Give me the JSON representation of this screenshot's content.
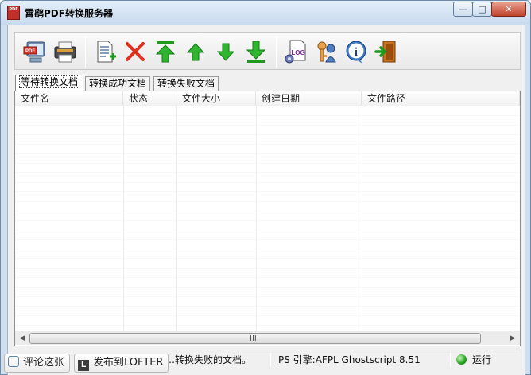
{
  "window": {
    "title": "霄鹞PDF转换服务器",
    "icon_text": "PDF",
    "buttons": {
      "minimize": "—",
      "maximize": "□",
      "close": "✕"
    }
  },
  "toolbar": {
    "icons": [
      "pdf-computer-icon",
      "printer-icon",
      "add-file-icon",
      "delete-icon",
      "move-top-icon",
      "move-up-icon",
      "move-down-icon",
      "move-bottom-icon",
      "log-icon",
      "user-key-icon",
      "info-icon",
      "exit-icon"
    ],
    "log_label": "LOG",
    "info_label": "i"
  },
  "tabs": [
    {
      "label": "等待转换文档",
      "active": true
    },
    {
      "label": "转换成功文档",
      "active": false
    },
    {
      "label": "转换失败文档",
      "active": false
    }
  ],
  "table": {
    "columns": [
      "文件名",
      "状态",
      "文件大小",
      "创建日期",
      "文件路径"
    ]
  },
  "scrollbar": {
    "grip": "III",
    "left_arrow": "◀",
    "right_arrow": "▶"
  },
  "status": {
    "text": "…转换失败的文档。",
    "engine": "PS 引擎:AFPL Ghostscript 8.51",
    "state": "运行"
  },
  "overlay": {
    "comment_label": "评论这张",
    "lofter_icon": "L",
    "lofter_label": "发布到LOFTER"
  },
  "colors": {
    "accent": "#cfdff0",
    "status_running": "#1fa31b",
    "close_button": "#c0402a"
  }
}
